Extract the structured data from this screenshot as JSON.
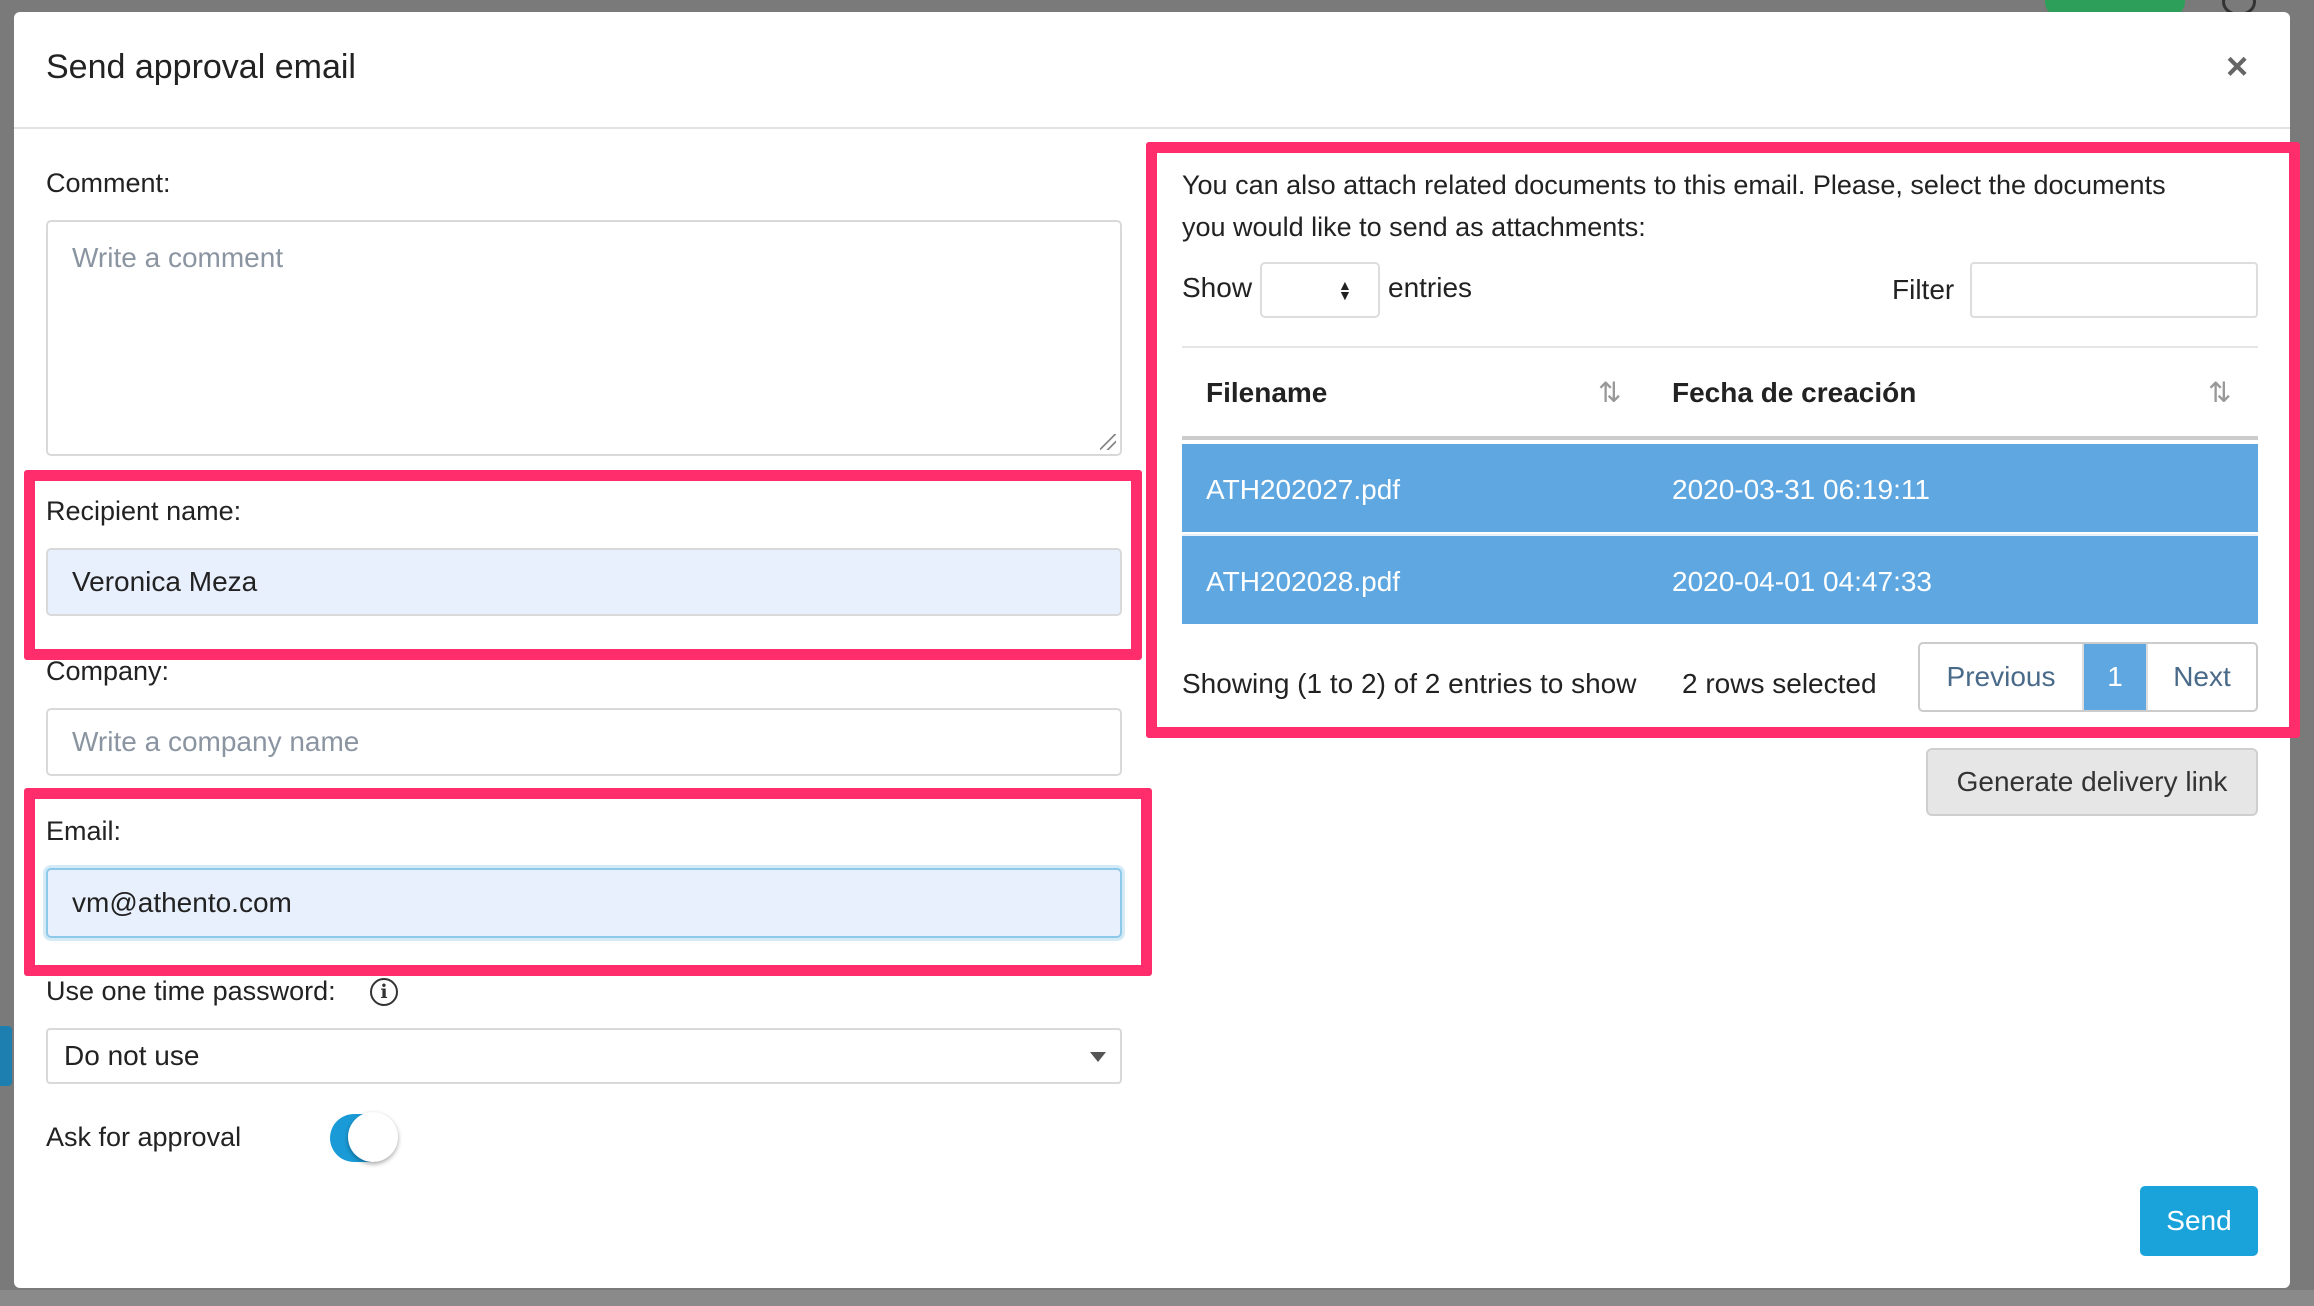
{
  "modal": {
    "title": "Send approval email",
    "close_icon": "×"
  },
  "form": {
    "comment": {
      "label": "Comment:",
      "placeholder": "Write a comment"
    },
    "recipient": {
      "label": "Recipient name:",
      "value": "Veronica Meza"
    },
    "company": {
      "label": "Company:",
      "placeholder": "Write a company name"
    },
    "email": {
      "label": "Email:",
      "value": "vm@athento.com"
    },
    "otp": {
      "label": "Use one time password:",
      "info_icon": "i",
      "selected": "Do not use"
    },
    "approval": {
      "label": "Ask for approval",
      "enabled": true
    }
  },
  "attachments": {
    "intro_line1": "You can also attach related documents to this email. Please, select the documents",
    "intro_line2": "you would like to send as attachments:",
    "show_label": "Show",
    "entries_label": "entries",
    "filter_label": "Filter",
    "columns": [
      "Filename",
      "Fecha de creación"
    ],
    "sort_icon": "⇅",
    "rows": [
      {
        "filename": "ATH202027.pdf",
        "created": "2020-03-31 06:19:11",
        "selected": true
      },
      {
        "filename": "ATH202028.pdf",
        "created": "2020-04-01 04:47:33",
        "selected": true
      }
    ],
    "info": "Showing (1 to 2) of 2 entries to show",
    "selection": "2 rows selected",
    "pagination": {
      "previous": "Previous",
      "current": "1",
      "next": "Next"
    }
  },
  "actions": {
    "generate_link": "Generate delivery link",
    "send": "Send"
  },
  "colors": {
    "highlight": "#ff2d6b",
    "selected_row": "#5fa7e0",
    "primary": "#1aa3db",
    "toggle_on": "#1a9bd7"
  }
}
